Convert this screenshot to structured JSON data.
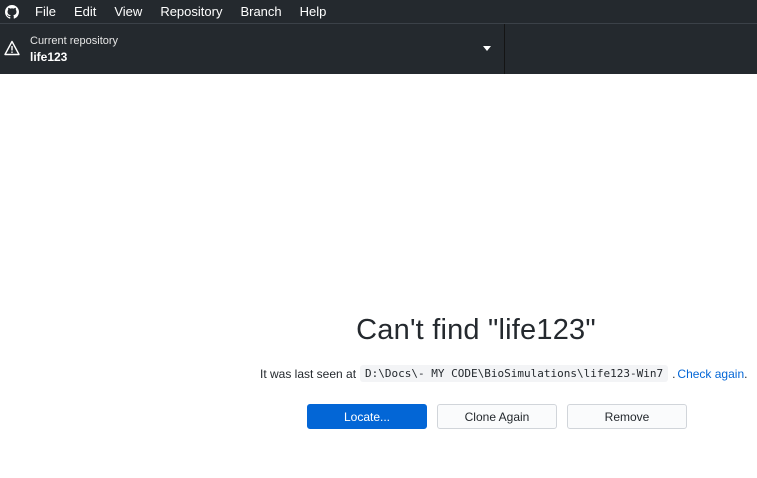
{
  "menubar": {
    "app_icon": "github-octocat-icon",
    "items": [
      {
        "label": "File"
      },
      {
        "label": "Edit"
      },
      {
        "label": "View"
      },
      {
        "label": "Repository"
      },
      {
        "label": "Branch"
      },
      {
        "label": "Help"
      }
    ]
  },
  "toolbar": {
    "repository": {
      "caption": "Current repository",
      "name": "life123",
      "status_icon": "warning-icon"
    }
  },
  "main": {
    "title": "Can't find \"life123\"",
    "last_seen_prefix": "It was last seen at",
    "last_seen_path": "D:\\Docs\\- MY CODE\\BioSimulations\\life123-Win7",
    "period_separator": ".",
    "check_again_label": "Check again",
    "trailing_period": ".",
    "buttons": {
      "locate": "Locate...",
      "clone_again": "Clone Again",
      "remove": "Remove"
    }
  },
  "colors": {
    "chrome": "#24292e",
    "primary_button": "#0366d6",
    "link": "#0366d6"
  }
}
